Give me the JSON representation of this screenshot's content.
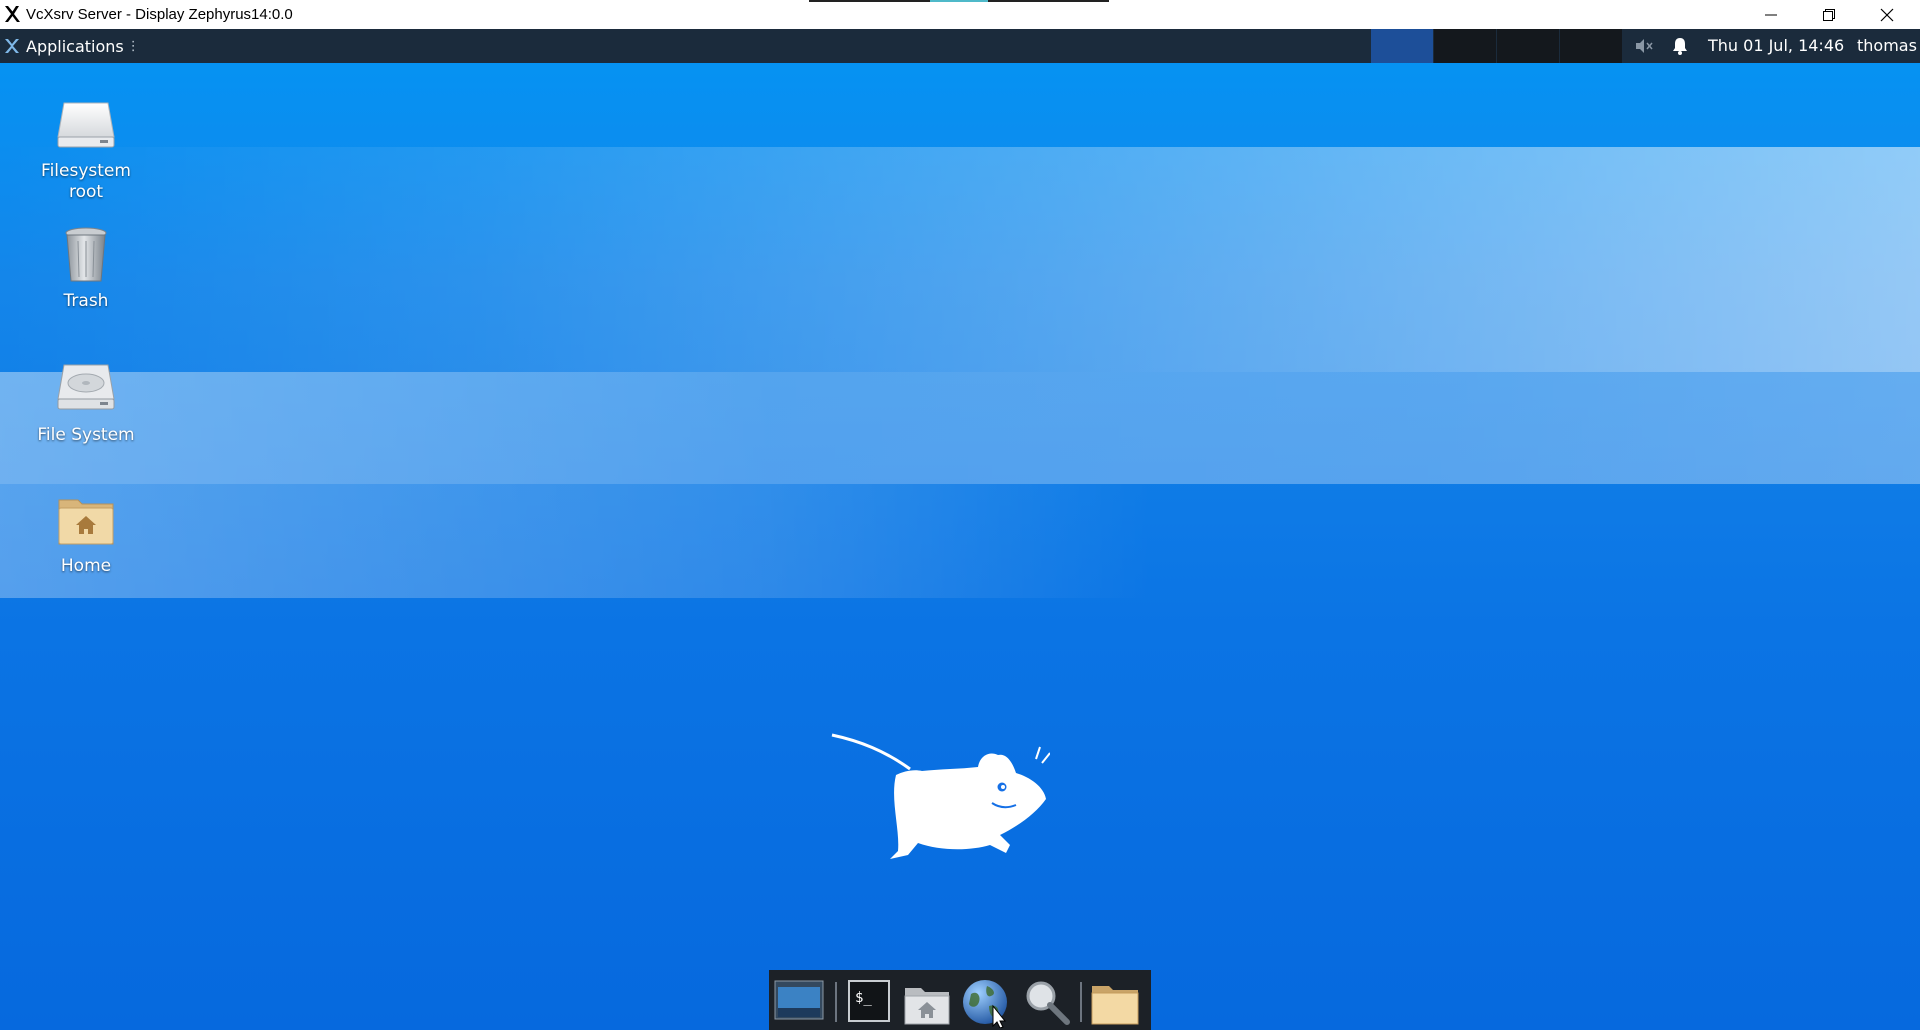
{
  "window": {
    "title": "VcXsrv Server - Display Zephyrus14:0.0",
    "minimize_icon": "minimize-icon",
    "restore_icon": "restore-icon",
    "close_icon": "close-icon"
  },
  "panel": {
    "applications_label": "Applications",
    "handle": "⋮",
    "workspaces": [
      {
        "active": true
      },
      {
        "active": false
      },
      {
        "active": false
      },
      {
        "active": false
      }
    ],
    "volume_icon": "volume-muted-icon",
    "notification_icon": "bell-icon",
    "clock": "Thu 01 Jul, 14:46",
    "user": "thomas"
  },
  "desktop_icons": [
    {
      "label_line1": "Filesystem",
      "label_line2": "root",
      "icon": "drive-icon"
    },
    {
      "label": "Trash",
      "icon": "trash-icon"
    },
    {
      "label": "File System",
      "icon": "hard-disk-icon"
    },
    {
      "label": "Home",
      "icon": "home-folder-icon"
    }
  ],
  "dock": {
    "items": [
      {
        "name": "show-desktop",
        "icon": "show-desktop-icon"
      },
      {
        "name": "terminal",
        "icon": "terminal-icon",
        "text": "$_"
      },
      {
        "name": "file-manager",
        "icon": "home-folder-icon"
      },
      {
        "name": "web-browser",
        "icon": "globe-icon"
      },
      {
        "name": "app-finder",
        "icon": "magnifier-icon"
      },
      {
        "name": "folder",
        "icon": "folder-icon"
      }
    ]
  },
  "colors": {
    "desktop_top": "#0394f4",
    "desktop_bottom": "#0669de",
    "panel": "#1b2b3c",
    "active_workspace": "#1d4f99",
    "dock": "#1c2127"
  }
}
